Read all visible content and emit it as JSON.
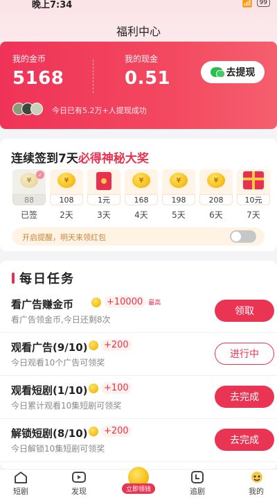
{
  "status": {
    "time": "晚上7:34",
    "battery": "99"
  },
  "header": {
    "title": "福利中心"
  },
  "wallet": {
    "coins_label": "我的金币",
    "coins_value": "5168",
    "cash_label": "我的现金",
    "cash_value": "0.51",
    "withdraw_label": "去提现",
    "notice": "今日已有5.2万+人提现成功"
  },
  "signin": {
    "title_prefix": "连续签到7天",
    "title_highlight": "必得神秘大奖",
    "days": [
      {
        "amount": "88",
        "label": "已签",
        "prize": "coin",
        "signed": true
      },
      {
        "amount": "108",
        "label": "2天",
        "prize": "coin",
        "signed": false
      },
      {
        "amount": "1元",
        "label": "3天",
        "prize": "redpack",
        "signed": false
      },
      {
        "amount": "168",
        "label": "4天",
        "prize": "coin",
        "signed": false
      },
      {
        "amount": "198",
        "label": "5天",
        "prize": "coin",
        "signed": false
      },
      {
        "amount": "208",
        "label": "6天",
        "prize": "coin",
        "signed": false
      },
      {
        "amount": "10元",
        "label": "7天",
        "prize": "gift",
        "signed": false
      }
    ],
    "reminder_text": "开启提醒，明天来领红包",
    "reminder_on": false
  },
  "tasks": {
    "title": "每日任务",
    "items": [
      {
        "name": "看广告赚金币",
        "reward": "+10000",
        "cap": "最高",
        "desc": "看广告领金币,今日还剩8次",
        "button": "领取",
        "button_style": "solid"
      },
      {
        "name": "观看广告(9/10)",
        "reward": "+200",
        "cap": "",
        "desc": "今日观看10个广告可领奖",
        "button": "进行中",
        "button_style": "outline"
      },
      {
        "name": "观看短剧(1/10)",
        "reward": "+100",
        "cap": "",
        "desc": "今日累计观看10集短剧可领奖",
        "button": "去完成",
        "button_style": "solid"
      },
      {
        "name": "解锁短剧(8/10)",
        "reward": "+200",
        "cap": "",
        "desc": "今日解锁10集短剧可领奖",
        "button": "去完成",
        "button_style": "solid"
      }
    ]
  },
  "bottom_nav": {
    "items": [
      {
        "label": "短剧",
        "icon": "home-icon"
      },
      {
        "label": "发现",
        "icon": "play-icon"
      },
      {
        "label": "立即领钱",
        "icon": "coin-icon"
      },
      {
        "label": "追剧",
        "icon": "follow-icon"
      },
      {
        "label": "我的",
        "icon": "me-icon"
      }
    ]
  },
  "colors": {
    "accent": "#ea3453",
    "wallet_gradient_start": "#ef3358",
    "wallet_gradient_end": "#f45f6e",
    "coin": "#f8c21d"
  }
}
